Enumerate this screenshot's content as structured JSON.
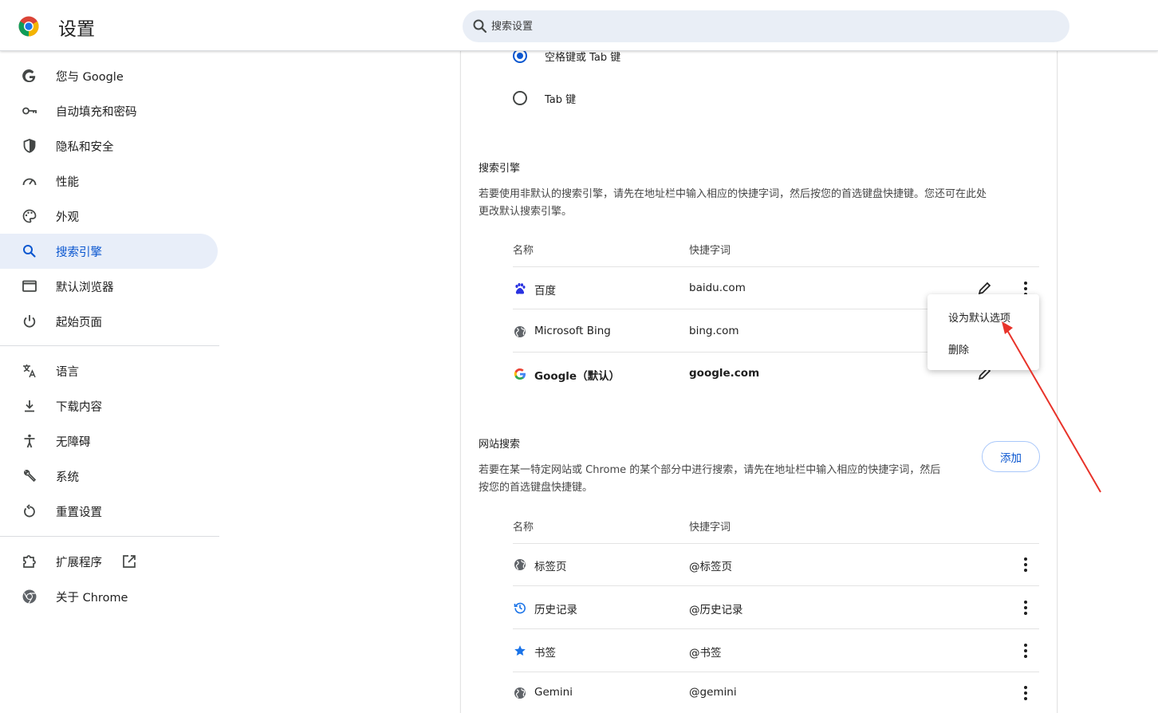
{
  "header": {
    "title": "设置",
    "search_placeholder": "搜索设置"
  },
  "sidebar": {
    "items": [
      {
        "label": "您与 Google",
        "icon": "google-g-icon"
      },
      {
        "label": "自动填充和密码",
        "icon": "key-icon"
      },
      {
        "label": "隐私和安全",
        "icon": "shield-icon"
      },
      {
        "label": "性能",
        "icon": "speedometer-icon"
      },
      {
        "label": "外观",
        "icon": "palette-icon"
      },
      {
        "label": "搜索引擎",
        "icon": "search-icon",
        "active": true
      },
      {
        "label": "默认浏览器",
        "icon": "browser-window-icon"
      },
      {
        "label": "起始页面",
        "icon": "power-icon"
      },
      {
        "label": "语言",
        "icon": "translate-icon"
      },
      {
        "label": "下载内容",
        "icon": "download-icon"
      },
      {
        "label": "无障碍",
        "icon": "accessibility-icon"
      },
      {
        "label": "系统",
        "icon": "wrench-icon"
      },
      {
        "label": "重置设置",
        "icon": "reset-icon"
      },
      {
        "label": "扩展程序",
        "icon": "puzzle-icon"
      },
      {
        "label": "关于 Chrome",
        "icon": "chrome-icon"
      }
    ]
  },
  "shortcut_key": {
    "options": [
      {
        "label": "空格键或 Tab 键",
        "checked": true
      },
      {
        "label": "Tab 键",
        "checked": false
      }
    ]
  },
  "search_engines": {
    "title": "搜索引擎",
    "description_line1": "若要使用非默认的搜索引擎，请先在地址栏中输入相应的快捷字词，然后按您的首选键盘快捷键。您还可在此处",
    "description_line2": "更改默认搜索引擎。",
    "col_name": "名称",
    "col_shortcut": "快捷字词",
    "rows": [
      {
        "name": "百度",
        "shortcut": "baidu.com",
        "icon": "baidu-paw-icon"
      },
      {
        "name": "Microsoft Bing",
        "shortcut": "bing.com",
        "icon": "globe-icon"
      },
      {
        "name": "Google（默认）",
        "shortcut": "google.com",
        "icon": "google-g-icon"
      }
    ]
  },
  "site_search": {
    "title": "网站搜索",
    "add_label": "添加",
    "description_line1": "若要在某一特定网站或 Chrome 的某个部分中进行搜索，请先在地址栏中输入相应的快捷字词，然后",
    "description_line2": "按您的首选键盘快捷键。",
    "col_name": "名称",
    "col_shortcut": "快捷字词",
    "rows": [
      {
        "name": "标签页",
        "shortcut": "@标签页",
        "icon": "globe-icon"
      },
      {
        "name": "历史记录",
        "shortcut": "@历史记录",
        "icon": "history-icon"
      },
      {
        "name": "书签",
        "shortcut": "@书签",
        "icon": "star-icon"
      },
      {
        "name": "Gemini",
        "shortcut": "@gemini",
        "icon": "globe-icon"
      }
    ]
  },
  "menu": {
    "set_default": "设为默认选项",
    "delete": "删除"
  },
  "colors": {
    "accent": "#0b57d0",
    "active_bg": "#e8eef9",
    "annotation_arrow": "#e8332a"
  }
}
